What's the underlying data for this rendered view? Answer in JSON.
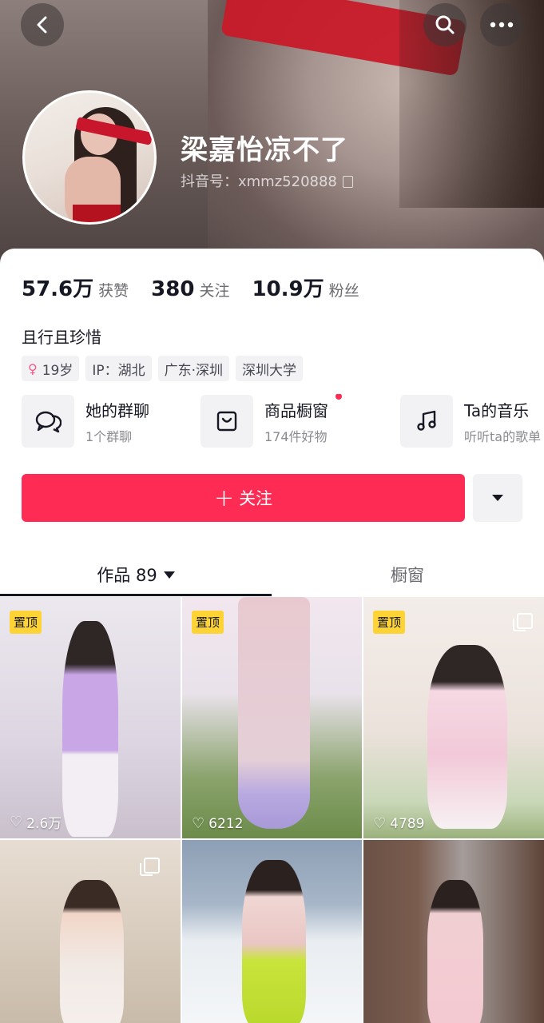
{
  "header": {
    "nickname": "梁嘉怡凉不了",
    "douyin_id": "抖音号：xmmz520888",
    "icons": [
      "back-arrow-icon",
      "search-icon",
      "more-icon"
    ]
  },
  "stats": [
    {
      "value": "57.6万",
      "label": "获赞"
    },
    {
      "value": "380",
      "label": "关注"
    },
    {
      "value": "10.9万",
      "label": "粉丝"
    }
  ],
  "bio": "且行且珍惜",
  "tags": {
    "age": "19岁",
    "ip": "IP：湖北",
    "location": "广东·深圳",
    "school": "深圳大学"
  },
  "shortcuts": [
    {
      "title": "她的群聊",
      "sub": "1个群聊",
      "icon": "chat-bubbles-icon"
    },
    {
      "title": "商品橱窗",
      "sub": "174件好物",
      "icon": "shopping-bag-icon"
    },
    {
      "title": "Ta的音乐",
      "sub": "听听ta的歌单",
      "icon": "music-note-icon"
    }
  ],
  "follow_label": "关注",
  "tabs": {
    "works": "作品 89",
    "shop": "橱窗"
  },
  "videos": [
    {
      "pin": "置顶",
      "likes": "2.6万"
    },
    {
      "pin": "置顶",
      "likes": "6212"
    },
    {
      "pin": "置顶",
      "likes": "4789"
    },
    {
      "pin": "",
      "likes": ""
    },
    {
      "pin": "",
      "likes": ""
    },
    {
      "pin": "",
      "likes": ""
    }
  ],
  "colors": {
    "accent": "#fe2c55",
    "pin_badge": "#fdd335",
    "tag_bg": "#f2f2f4"
  }
}
